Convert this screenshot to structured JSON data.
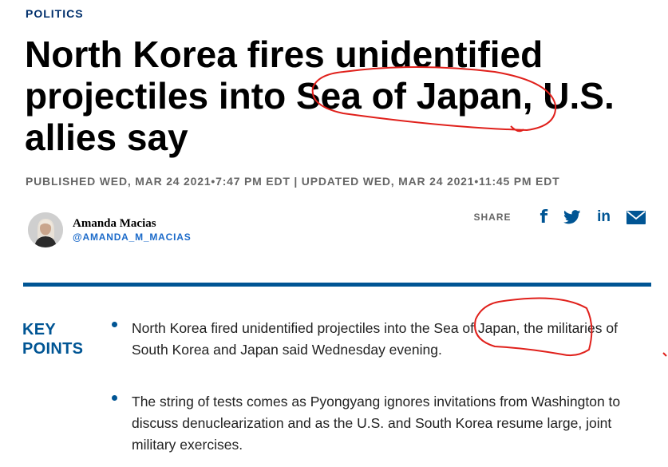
{
  "section": {
    "label": "POLITICS"
  },
  "article": {
    "headline": "North Korea fires unidentified projectiles into Sea of Japan, U.S. allies say",
    "timestamp": "PUBLISHED WED, MAR 24 2021•7:47 PM EDT | UPDATED WED, MAR 24 2021•11:45 PM EDT"
  },
  "author": {
    "name": "Amanda Macias",
    "handle": "@AMANDA_M_MACIAS"
  },
  "share": {
    "label": "SHARE",
    "icons": [
      "facebook-icon",
      "twitter-icon",
      "linkedin-icon",
      "email-icon"
    ],
    "facebook_glyph": "f",
    "linkedin_glyph": "in"
  },
  "key_points": {
    "label": "KEY POINTS",
    "items": [
      "North Korea fired unidentified projectiles into the Sea of Japan, the militaries of South Korea and Japan said Wednesday evening.",
      "The string of tests comes as Pyongyang ignores invitations from Washington to discuss denuclearization and as the U.S. and South Korea resume large, joint military exercises."
    ]
  },
  "colors": {
    "accent": "#005594",
    "section_label": "#002f6c",
    "handle": "#1b6ac9",
    "meta_text": "#666666",
    "annotation": "#e0201b"
  }
}
